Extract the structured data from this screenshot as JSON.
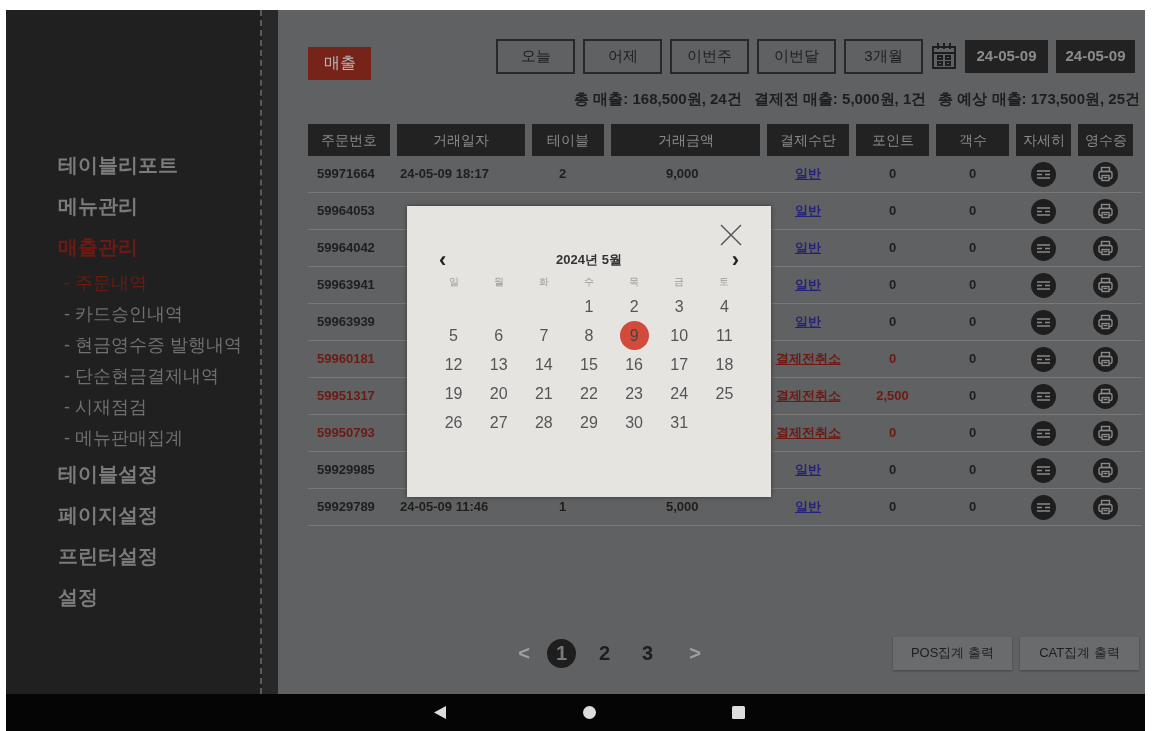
{
  "sidebar": {
    "items": [
      {
        "label": "테이블리포트",
        "selected": false
      },
      {
        "label": "메뉴관리",
        "selected": false
      },
      {
        "label": "매출관리",
        "selected": true,
        "children": [
          {
            "label": "- 주문내역",
            "selected": true
          },
          {
            "label": "- 카드승인내역",
            "selected": false
          },
          {
            "label": "- 현금영수증 발행내역",
            "selected": false
          },
          {
            "label": "- 단순현금결제내역",
            "selected": false
          },
          {
            "label": "- 시재점검",
            "selected": false
          },
          {
            "label": "- 메뉴판매집계",
            "selected": false
          }
        ]
      },
      {
        "label": "테이블설정",
        "selected": false
      },
      {
        "label": "페이지설정",
        "selected": false
      },
      {
        "label": "프린터설정",
        "selected": false
      },
      {
        "label": "설정",
        "selected": false
      }
    ]
  },
  "page_title": "매출",
  "periods": [
    "오늘",
    "어제",
    "이번주",
    "이번달",
    "3개월"
  ],
  "date_range": {
    "start": "24-05-09",
    "end": "24-05-09"
  },
  "summary": [
    "총 매출: 168,500원, 24건",
    "결제전 매출: 5,000원, 1건",
    "총 예상 매출: 173,500원, 25건"
  ],
  "table": {
    "columns": [
      "주문번호",
      "거래일자",
      "테이블",
      "거래금액",
      "결제수단",
      "포인트",
      "객수",
      "자세히",
      "영수증"
    ],
    "rows": [
      {
        "cancelled": false,
        "order": "59971664",
        "date": "24-05-09 18:17",
        "table": "2",
        "amount": "9,000",
        "payment": "일반",
        "points": "0",
        "guests": "0"
      },
      {
        "cancelled": false,
        "order": "59964053",
        "date": null,
        "table": null,
        "amount": null,
        "payment": "일반",
        "points": "0",
        "guests": "0"
      },
      {
        "cancelled": false,
        "order": "59964042",
        "date": null,
        "table": null,
        "amount": null,
        "payment": "일반",
        "points": "0",
        "guests": "0"
      },
      {
        "cancelled": false,
        "order": "59963941",
        "date": null,
        "table": null,
        "amount": null,
        "payment": "일반",
        "points": "0",
        "guests": "0"
      },
      {
        "cancelled": false,
        "order": "59963939",
        "date": null,
        "table": null,
        "amount": null,
        "payment": "일반",
        "points": "0",
        "guests": "0"
      },
      {
        "cancelled": true,
        "order": "59960181",
        "date": null,
        "table": null,
        "amount": null,
        "payment": "결제전취소",
        "points": "0",
        "guests": "0"
      },
      {
        "cancelled": true,
        "order": "59951317",
        "date": null,
        "table": null,
        "amount": null,
        "payment": "결제전취소",
        "points": "2,500",
        "guests": "0"
      },
      {
        "cancelled": true,
        "order": "59950793",
        "date": null,
        "table": null,
        "amount": null,
        "payment": "결제전취소",
        "points": "0",
        "guests": "0"
      },
      {
        "cancelled": false,
        "order": "59929985",
        "date": null,
        "table": null,
        "amount": null,
        "payment": "일반",
        "points": "0",
        "guests": "0"
      },
      {
        "cancelled": false,
        "order": "59929789",
        "date": "24-05-09 11:46",
        "table": "1",
        "amount": "5,000",
        "payment": "일반",
        "points": "0",
        "guests": "0"
      }
    ]
  },
  "pagination": {
    "prev": "<",
    "next": ">",
    "pages": [
      {
        "label": "1",
        "selected": true
      },
      {
        "label": "2",
        "selected": false
      },
      {
        "label": "3",
        "selected": false
      }
    ]
  },
  "actions": [
    "POS집계 출력",
    "CAT집계 출력"
  ],
  "calendar": {
    "title": "2024년 5월",
    "prev": "‹",
    "next": "›",
    "weekdays": [
      "일",
      "월",
      "화",
      "수",
      "목",
      "금",
      "토"
    ],
    "weeks": [
      [
        {
          "day": "1",
          "selected": false
        },
        {
          "day": "2",
          "selected": false
        },
        {
          "day": "3",
          "selected": false
        },
        {
          "day": "4",
          "selected": false
        }
      ],
      [
        {
          "day": "5",
          "selected": false
        },
        {
          "day": "6",
          "selected": false
        },
        {
          "day": "7",
          "selected": false
        },
        {
          "day": "8",
          "selected": false
        },
        {
          "day": "9",
          "selected": true
        },
        {
          "day": "10",
          "selected": false
        },
        {
          "day": "11",
          "selected": false
        }
      ],
      [
        {
          "day": "12",
          "selected": false
        },
        {
          "day": "13",
          "selected": false
        },
        {
          "day": "14",
          "selected": false
        },
        {
          "day": "15",
          "selected": false
        },
        {
          "day": "16",
          "selected": false
        },
        {
          "day": "17",
          "selected": false
        },
        {
          "day": "18",
          "selected": false
        }
      ],
      [
        {
          "day": "19",
          "selected": false
        },
        {
          "day": "20",
          "selected": false
        },
        {
          "day": "21",
          "selected": false
        },
        {
          "day": "22",
          "selected": false
        },
        {
          "day": "23",
          "selected": false
        },
        {
          "day": "24",
          "selected": false
        },
        {
          "day": "25",
          "selected": false
        }
      ],
      [
        {
          "day": "26",
          "selected": false
        },
        {
          "day": "27",
          "selected": false
        },
        {
          "day": "28",
          "selected": false
        },
        {
          "day": "29",
          "selected": false
        },
        {
          "day": "30",
          "selected": false
        },
        {
          "day": "31",
          "selected": false
        }
      ]
    ]
  }
}
